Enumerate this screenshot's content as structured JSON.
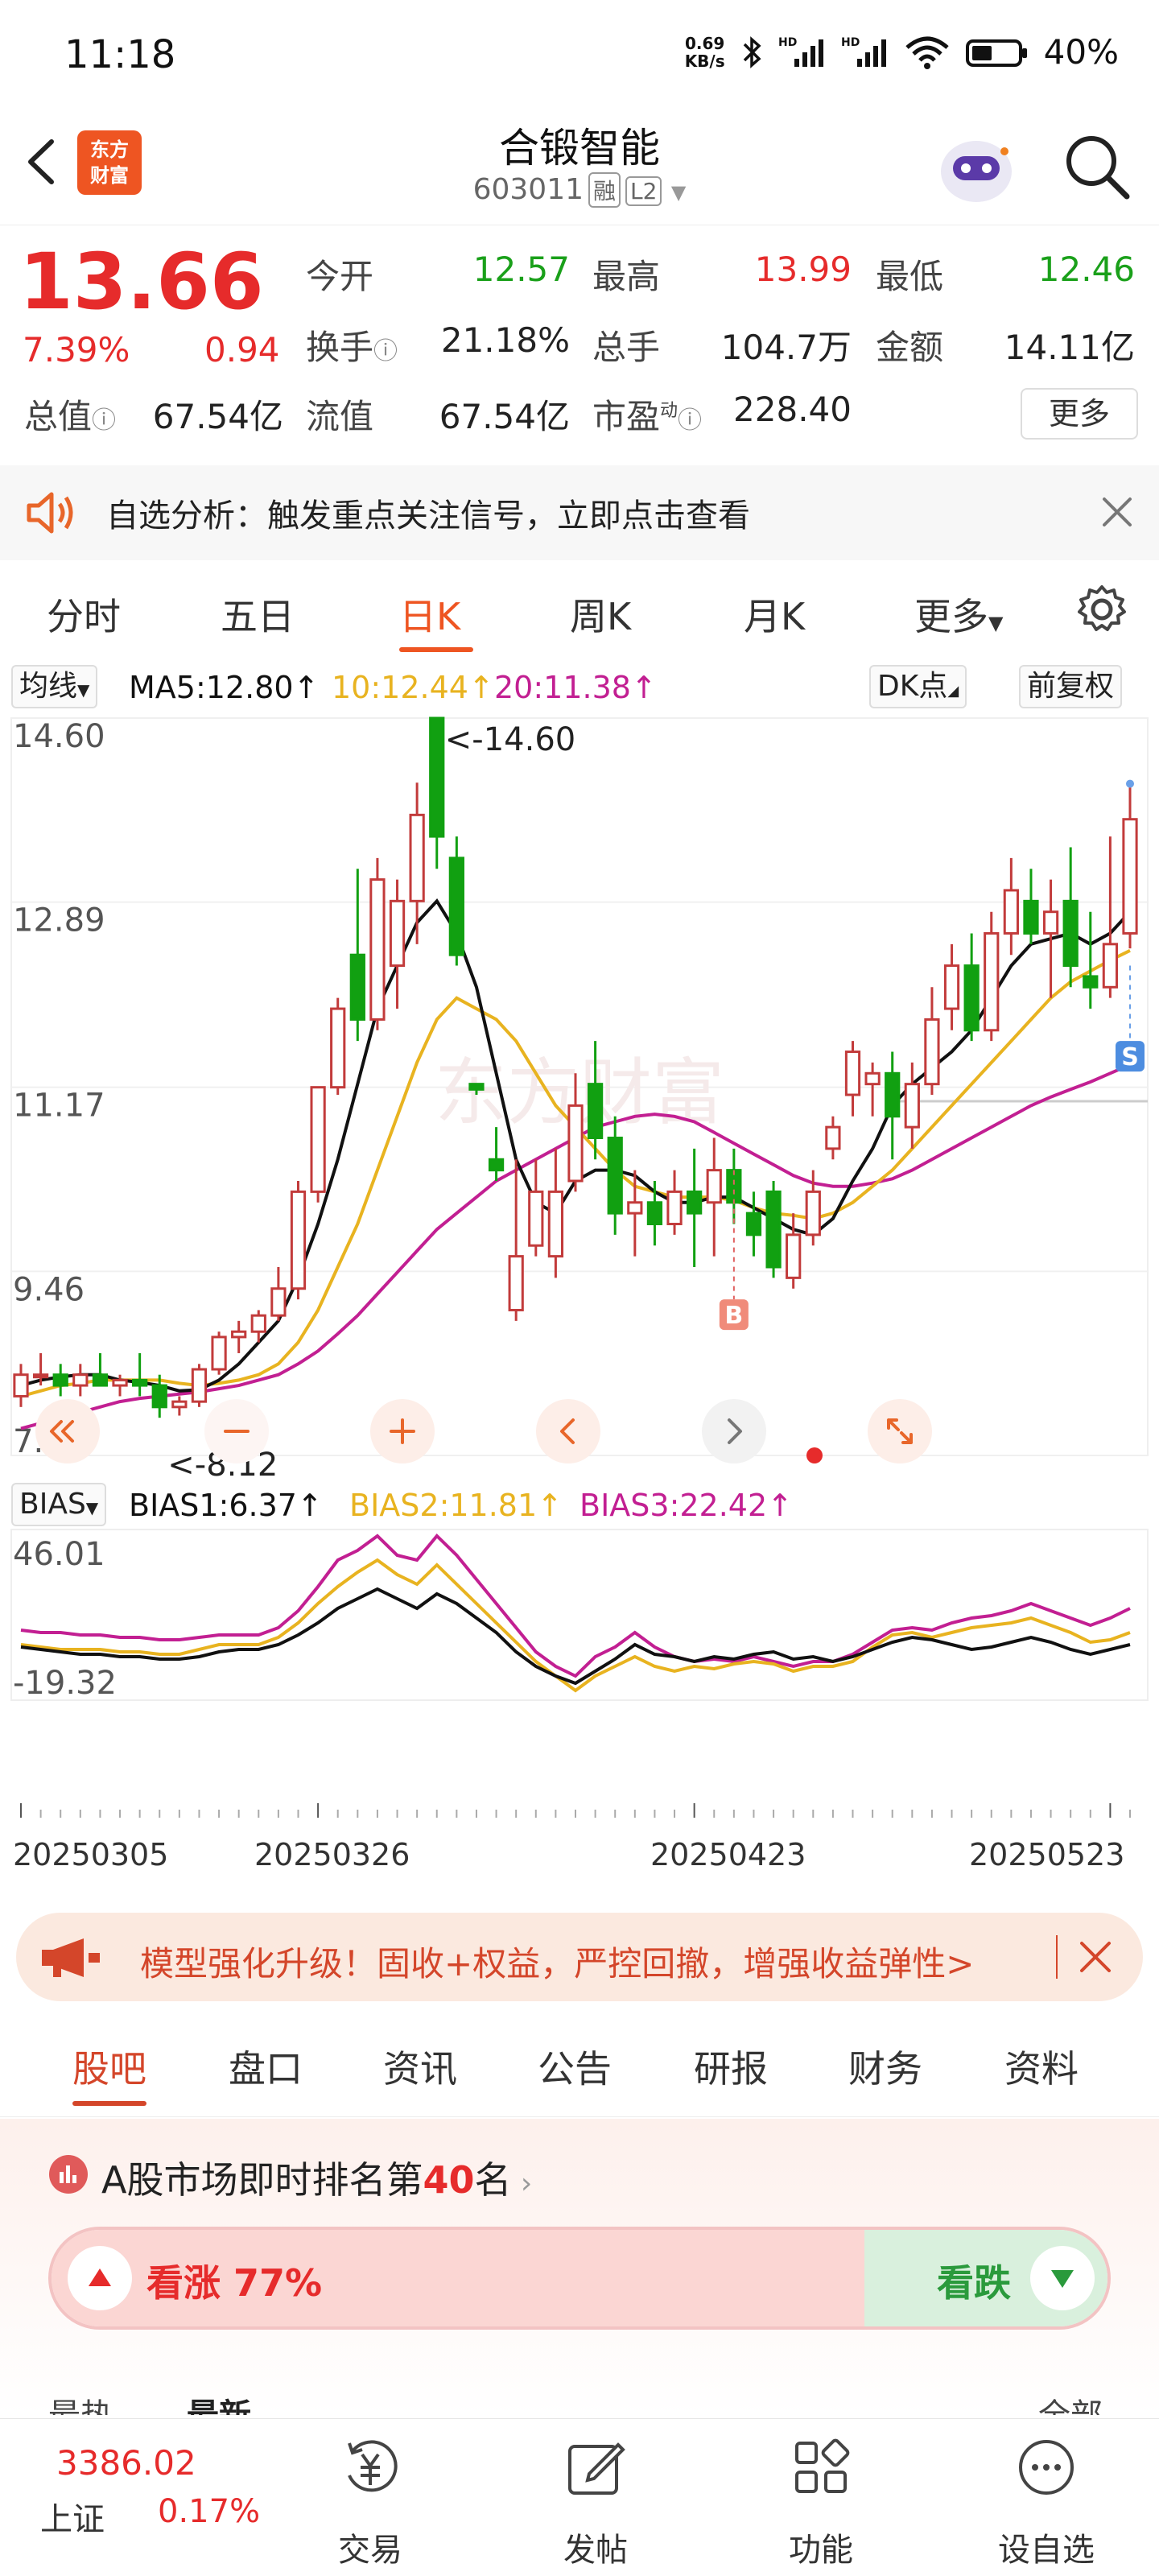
{
  "status_bar": {
    "time": "11:18",
    "net_speed_value": "0.69",
    "net_speed_unit": "KB/s",
    "battery": "40%",
    "icons": [
      "bluetooth-icon",
      "signal-hd-icon",
      "signal-hd-icon",
      "wifi-icon",
      "battery-icon"
    ]
  },
  "header": {
    "title": "合锻智能",
    "code": "603011",
    "tag_margin": "融",
    "tag_level": "L2",
    "logo_line1": "东方",
    "logo_line2": "财富"
  },
  "quote": {
    "price": "13.66",
    "change_pct": "7.39%",
    "change_amt": "0.94",
    "open_label": "今开",
    "open_value": "12.57",
    "high_label": "最高",
    "high_value": "13.99",
    "low_label": "最低",
    "low_value": "12.46",
    "turnover_label": "换手",
    "turnover_value": "21.18%",
    "volume_label": "总手",
    "volume_value": "104.7万",
    "amount_label": "金额",
    "amount_value": "14.11亿",
    "mktcap_label": "总值",
    "mktcap_value": "67.54亿",
    "float_label": "流值",
    "float_value": "67.54亿",
    "pe_label": "市盈",
    "pe_sup": "动",
    "pe_value": "228.40",
    "more_label": "更多"
  },
  "notice": {
    "text": "自选分析：触发重点关注信号，立即点击查看"
  },
  "tabs": [
    "分时",
    "五日",
    "日K",
    "周K",
    "月K",
    "更多"
  ],
  "active_tab": 2,
  "ma_bar": {
    "selector": "均线",
    "ma5": "MA5:12.80",
    "ma10": "10:12.44",
    "ma20": "20:11.38",
    "dk": "DK点",
    "adjust": "前复权"
  },
  "chart_data": {
    "type": "candlestick",
    "price_axis_labels": [
      "14.60",
      "12.89",
      "11.17",
      "9.46",
      "7.75"
    ],
    "ylim": [
      7.75,
      14.6
    ],
    "max_annotation": "<-14.60",
    "min_annotation": "<-8.12",
    "buy_marker": "B",
    "sell_marker": "S",
    "candles": [
      [
        8.3,
        8.6,
        8.2,
        8.5
      ],
      [
        8.5,
        8.7,
        8.4,
        8.5
      ],
      [
        8.5,
        8.6,
        8.3,
        8.4
      ],
      [
        8.4,
        8.6,
        8.3,
        8.5
      ],
      [
        8.5,
        8.7,
        8.4,
        8.4
      ],
      [
        8.4,
        8.5,
        8.3,
        8.45
      ],
      [
        8.45,
        8.7,
        8.3,
        8.4
      ],
      [
        8.4,
        8.5,
        8.1,
        8.2
      ],
      [
        8.2,
        8.3,
        8.12,
        8.25
      ],
      [
        8.25,
        8.6,
        8.2,
        8.55
      ],
      [
        8.55,
        8.9,
        8.5,
        8.85
      ],
      [
        8.85,
        9.0,
        8.7,
        8.9
      ],
      [
        8.9,
        9.1,
        8.8,
        9.05
      ],
      [
        9.05,
        9.5,
        9.0,
        9.3
      ],
      [
        9.3,
        10.3,
        9.2,
        10.2
      ],
      [
        10.2,
        11.17,
        10.1,
        11.17
      ],
      [
        11.17,
        12.0,
        11.1,
        11.9
      ],
      [
        12.4,
        13.2,
        11.6,
        11.8
      ],
      [
        11.8,
        13.3,
        11.7,
        13.1
      ],
      [
        12.3,
        13.1,
        11.9,
        12.9
      ],
      [
        12.9,
        14.0,
        12.5,
        13.7
      ],
      [
        14.6,
        14.6,
        13.2,
        13.5
      ],
      [
        13.3,
        13.5,
        12.3,
        12.4
      ],
      [
        11.2,
        11.2,
        11.1,
        11.15
      ],
      [
        10.5,
        10.8,
        10.3,
        10.4
      ],
      [
        9.1,
        10.5,
        9.0,
        9.6
      ],
      [
        9.7,
        10.5,
        9.6,
        10.2
      ],
      [
        9.6,
        10.6,
        9.4,
        10.2
      ],
      [
        10.3,
        11.3,
        10.2,
        11.0
      ],
      [
        11.2,
        11.6,
        10.5,
        10.7
      ],
      [
        10.7,
        10.9,
        9.8,
        10.0
      ],
      [
        10.0,
        10.4,
        9.6,
        10.1
      ],
      [
        10.1,
        10.3,
        9.7,
        9.9
      ],
      [
        9.9,
        10.4,
        9.8,
        10.2
      ],
      [
        10.2,
        10.6,
        9.5,
        10.0
      ],
      [
        10.1,
        10.7,
        9.6,
        10.4
      ],
      [
        10.4,
        10.6,
        9.9,
        10.1
      ],
      [
        10.0,
        10.2,
        9.6,
        9.8
      ],
      [
        10.2,
        10.3,
        9.4,
        9.5
      ],
      [
        9.4,
        10.0,
        9.3,
        9.8
      ],
      [
        9.8,
        10.4,
        9.7,
        10.2
      ],
      [
        10.6,
        10.9,
        10.5,
        10.8
      ],
      [
        11.1,
        11.6,
        10.9,
        11.5
      ],
      [
        11.2,
        11.4,
        10.9,
        11.3
      ],
      [
        11.3,
        11.5,
        10.5,
        10.9
      ],
      [
        10.8,
        11.4,
        10.6,
        11.2
      ],
      [
        11.2,
        12.1,
        11.1,
        11.8
      ],
      [
        11.9,
        12.5,
        11.7,
        12.3
      ],
      [
        12.3,
        12.6,
        11.6,
        11.7
      ],
      [
        11.7,
        12.8,
        11.6,
        12.6
      ],
      [
        12.6,
        13.3,
        12.4,
        13.0
      ],
      [
        12.9,
        13.2,
        12.5,
        12.6
      ],
      [
        12.6,
        13.1,
        12.0,
        12.8
      ],
      [
        12.9,
        13.4,
        12.1,
        12.3
      ],
      [
        12.2,
        12.8,
        11.9,
        12.1
      ],
      [
        12.1,
        13.5,
        12.0,
        12.5
      ],
      [
        12.6,
        13.99,
        12.46,
        13.66
      ]
    ],
    "ma5": [
      8.4,
      8.45,
      8.48,
      8.5,
      8.5,
      8.45,
      8.43,
      8.4,
      8.35,
      8.36,
      8.45,
      8.6,
      8.8,
      9.0,
      9.4,
      9.9,
      10.5,
      11.2,
      11.9,
      12.3,
      12.7,
      12.9,
      12.6,
      12.1,
      11.3,
      10.5,
      10.1,
      10.0,
      10.3,
      10.4,
      10.4,
      10.35,
      10.2,
      10.1,
      10.1,
      10.15,
      10.15,
      10.05,
      9.95,
      9.85,
      9.8,
      9.95,
      10.3,
      10.6,
      11.0,
      11.2,
      11.35,
      11.5,
      11.7,
      12.0,
      12.3,
      12.5,
      12.55,
      12.6,
      12.5,
      12.6,
      12.8
    ],
    "ma10": [
      8.3,
      8.35,
      8.4,
      8.42,
      8.45,
      8.45,
      8.45,
      8.45,
      8.42,
      8.4,
      8.42,
      8.45,
      8.5,
      8.6,
      8.8,
      9.1,
      9.5,
      9.9,
      10.4,
      10.9,
      11.4,
      11.8,
      12.0,
      11.9,
      11.8,
      11.6,
      11.3,
      11.0,
      10.8,
      10.6,
      10.4,
      10.25,
      10.2,
      10.15,
      10.15,
      10.15,
      10.12,
      10.05,
      10.0,
      9.98,
      9.95,
      10.0,
      10.1,
      10.25,
      10.4,
      10.6,
      10.8,
      11.0,
      11.2,
      11.4,
      11.6,
      11.8,
      12.0,
      12.15,
      12.25,
      12.35,
      12.44
    ],
    "ma20": [
      8.0,
      8.05,
      8.1,
      8.15,
      8.2,
      8.25,
      8.28,
      8.3,
      8.32,
      8.34,
      8.37,
      8.4,
      8.45,
      8.5,
      8.6,
      8.72,
      8.88,
      9.05,
      9.25,
      9.45,
      9.65,
      9.85,
      10.0,
      10.15,
      10.3,
      10.4,
      10.5,
      10.6,
      10.7,
      10.8,
      10.85,
      10.9,
      10.92,
      10.9,
      10.85,
      10.75,
      10.65,
      10.55,
      10.45,
      10.35,
      10.28,
      10.25,
      10.25,
      10.28,
      10.32,
      10.4,
      10.5,
      10.6,
      10.7,
      10.8,
      10.9,
      11.0,
      11.08,
      11.15,
      11.22,
      11.3,
      11.38
    ],
    "bias": {
      "selector": "BIAS",
      "bias1": "BIAS1:6.37",
      "bias2": "BIAS2:11.81",
      "bias3": "BIAS3:22.42",
      "axis_labels": [
        "46.01",
        "-19.32"
      ],
      "ylim": [
        -19.32,
        46.01
      ],
      "bias1_values": [
        0,
        -1,
        -2,
        -3,
        -3,
        -4,
        -4,
        -5,
        -5,
        -4,
        -2,
        -1,
        -1,
        1,
        5,
        10,
        16,
        20,
        24,
        20,
        16,
        22,
        18,
        12,
        6,
        -2,
        -8,
        -12,
        -15,
        -10,
        -5,
        1,
        -3,
        -4,
        -6,
        -4,
        -5,
        -3,
        -2,
        -5,
        -4,
        -6,
        -4,
        -1,
        2,
        4,
        3,
        1,
        -1,
        0,
        2,
        4,
        2,
        -1,
        -3,
        -1,
        1
      ],
      "bias2_values": [
        1,
        0,
        -1,
        -1,
        -1,
        -2,
        -2,
        -3,
        -3,
        -1,
        1,
        1,
        1,
        4,
        10,
        18,
        25,
        31,
        36,
        30,
        26,
        34,
        26,
        18,
        10,
        2,
        -6,
        -12,
        -18,
        -12,
        -8,
        -4,
        -8,
        -10,
        -8,
        -9,
        -7,
        -6,
        -7,
        -10,
        -8,
        -8,
        -6,
        0,
        5,
        6,
        4,
        6,
        8,
        9,
        10,
        12,
        9,
        6,
        2,
        3,
        6
      ],
      "bias3_values": [
        7,
        6,
        6,
        5,
        5,
        4,
        4,
        3,
        3,
        4,
        5,
        5,
        5,
        8,
        15,
        25,
        36,
        40,
        46,
        38,
        36,
        46,
        38,
        28,
        18,
        8,
        -2,
        -8,
        -12,
        -4,
        0,
        6,
        0,
        -4,
        -6,
        -5,
        -6,
        -4,
        -6,
        -8,
        -6,
        -6,
        -3,
        2,
        7,
        8,
        7,
        10,
        12,
        13,
        15,
        18,
        15,
        12,
        9,
        12,
        16
      ]
    },
    "date_labels": [
      "20250305",
      "20250326",
      "20250423",
      "20250523"
    ]
  },
  "banner": {
    "text": "模型强化升级！固收+权益，严控回撤，增强收益弹性>"
  },
  "bottom_tabs": [
    "股吧",
    "盘口",
    "资讯",
    "公告",
    "研报",
    "财务",
    "资料"
  ],
  "bottom_active": 0,
  "ranking": {
    "prefix": "A股市场即时排名第",
    "rank": "40",
    "suffix": "名",
    "bull_label": "看涨 77%",
    "bear_label": "看跌",
    "bull_pct": 77,
    "peek_left": "最热",
    "peek_mid": "最新",
    "peek_right": "全部"
  },
  "footer": {
    "index_value": "3386.02",
    "index_name": "上证",
    "index_change": "0.17%",
    "items": [
      "交易",
      "发帖",
      "功能",
      "设自选"
    ]
  },
  "colors": {
    "up": "#e62b2b",
    "down": "#1aa01a",
    "accent": "#ee5522",
    "ma5": "#111111",
    "ma10": "#e8b320",
    "ma20": "#c21f92"
  }
}
